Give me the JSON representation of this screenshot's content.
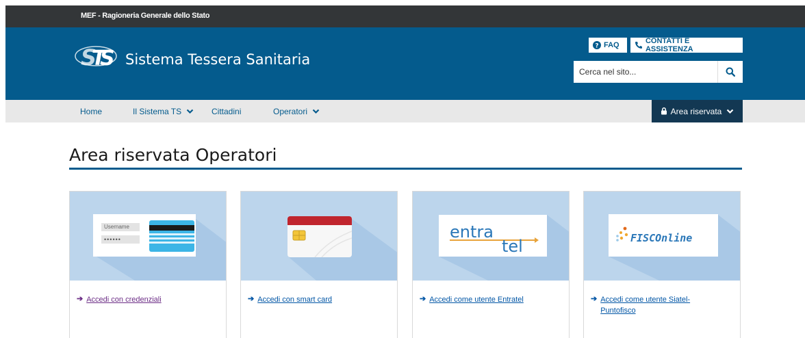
{
  "topbar": {
    "brand": "MEF - Ragioneria Generale dello Stato"
  },
  "header": {
    "logo_icon": "sts-logo-icon",
    "site_title": "Sistema Tessera Sanitaria",
    "faq_label": "FAQ",
    "contact_label": "CONTATTI E ASSISTENZA",
    "search_placeholder": "Cerca nel sito..."
  },
  "nav": {
    "items": [
      {
        "label": "Home"
      },
      {
        "label": "Il Sistema TS"
      },
      {
        "label": "Cittadini"
      },
      {
        "label": "Operatori"
      }
    ],
    "reserved_label": "Area riservata"
  },
  "main": {
    "title": "Area riservata Operatori",
    "cards": [
      {
        "link": "Accedi con credenziali",
        "username_label": "Username",
        "password_mask": "••••••"
      },
      {
        "link": "Accedi con smart card"
      },
      {
        "link": "Accedi come utente Entratel",
        "logo_part1": "entra",
        "logo_part2": "tel"
      },
      {
        "link": "Accedi come utente Siatel-Puntofisco",
        "logo_text": "FISCOnline"
      }
    ]
  },
  "colors": {
    "header_blue": "#045b8d",
    "topbar_dark": "#333638",
    "nav_dark": "#133853",
    "link_blue": "#0055a5",
    "link_visited": "#6b2c85"
  }
}
